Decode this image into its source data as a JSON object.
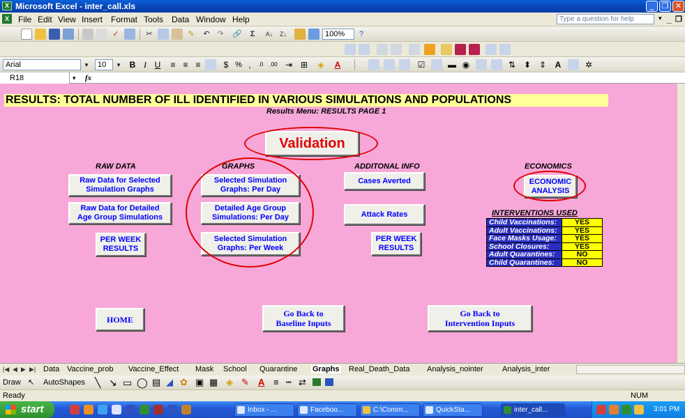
{
  "window": {
    "title": "Microsoft Excel - inter_call.xls"
  },
  "menu": {
    "items": [
      "File",
      "Edit",
      "View",
      "Insert",
      "Format",
      "Tools",
      "Data",
      "Window",
      "Help"
    ],
    "help_box_placeholder": "Type a question for help"
  },
  "toolbar": {
    "zoom": "100%",
    "font": "Arial",
    "font_size": "10"
  },
  "formula_bar": {
    "cell_ref": "R18",
    "fx": "fx"
  },
  "sheet": {
    "title": "RESULTS: TOTAL NUMBER OF ILL IDENTIFIED IN VARIOUS SIMULATIONS AND POPULATIONS",
    "subtitle": "Results Menu: RESULTS PAGE 1",
    "validation_label": "Validation",
    "sections": {
      "raw_data": "RAW DATA",
      "graphs": "GRAPHS",
      "additional": "ADDITONAL INFO",
      "economics": "ECONOMICS"
    },
    "buttons": {
      "raw_selected": [
        "Raw Data for Selected",
        "Simulation Graphs"
      ],
      "raw_detailed": [
        "Raw Data for Detailed",
        "Age Group Simulations"
      ],
      "raw_per_week": [
        "PER WEEK",
        "RESULTS"
      ],
      "graphs_per_day": [
        "Selected Simulation",
        "Graphs: Per Day"
      ],
      "graphs_age_per_day": [
        "Detailed Age Group",
        "Simulations: Per Day"
      ],
      "graphs_per_week": [
        "Selected Simulation",
        "Graphs: Per Week"
      ],
      "cases_averted": "Cases Averted",
      "attack_rates": "Attack Rates",
      "add_per_week": [
        "PER WEEK",
        "RESULTS"
      ],
      "economic": [
        "ECONOMIC",
        "ANALYSIS"
      ],
      "home": "HOME",
      "baseline": [
        "Go Back to",
        "Baseline Inputs"
      ],
      "intervention": [
        "Go Back to",
        "Intervention Inputs"
      ]
    },
    "interventions": {
      "title": "INTERVENTIONS USED",
      "rows": [
        {
          "label": "Child Vaccinations:",
          "value": "YES"
        },
        {
          "label": "Adult Vaccinations:",
          "value": "YES"
        },
        {
          "label": "Face Masks Usage:",
          "value": "YES"
        },
        {
          "label": "School Closures:",
          "value": "YES"
        },
        {
          "label": "Adult Quarantines:",
          "value": "NO"
        },
        {
          "label": "Child Quarantines:",
          "value": "NO"
        }
      ]
    }
  },
  "tabs": [
    "Data",
    "Vaccine_prob",
    "Vaccine_Effect",
    "Mask",
    "School",
    "Quarantine",
    "Graphs",
    "Real_Death_Data",
    "Analysis_nointer",
    "Analysis_inter"
  ],
  "active_tab": "Graphs",
  "drawing_toolbar": {
    "draw": "Draw",
    "autoshapes": "AutoShapes"
  },
  "status": {
    "left": "Ready",
    "mode": "NUM"
  },
  "taskbar": {
    "start": "start",
    "tasks": [
      "Inbox - ...",
      "Faceboo...",
      "C:\\Comm...",
      "QuickSta...",
      "inter_call..."
    ],
    "clock": "3:01 PM"
  }
}
